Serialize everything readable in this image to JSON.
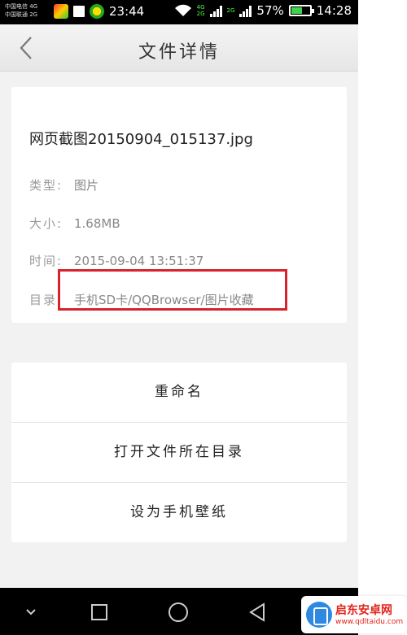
{
  "status_bar": {
    "carrier_line1": "中国电信 4G",
    "carrier_line2": "中国联通 2G",
    "left_time": "23:44",
    "net_tag_top": "4G",
    "net_tag_bottom": "2G",
    "net_tag_right": "2G",
    "battery_text": "57%",
    "battery_level": 0.57,
    "clock": "14:28"
  },
  "title_bar": {
    "title": "文件详情",
    "back_icon": "chevron-left-icon"
  },
  "file_info": {
    "file_name": "网页截图20150904_015137.jpg",
    "type_label": "类型:",
    "type_value": "图片",
    "size_label": "大小:",
    "size_value": "1.68MB",
    "time_label": "时间:",
    "time_value": "2015-09-04 13:51:37",
    "dir_label": "目录:",
    "dir_value": "手机SD卡/QQBrowser/图片收藏"
  },
  "actions": {
    "rename": "重命名",
    "open_dir": "打开文件所在目录",
    "set_wallpaper": "设为手机壁纸"
  },
  "nav_bar": {
    "icons": [
      "chevron-down-icon",
      "square-icon",
      "circle-icon",
      "triangle-back-icon"
    ]
  },
  "watermark": {
    "title": "启东安卓网",
    "url": "www.qdltaidu.com"
  },
  "colors": {
    "highlight": "#d9232b",
    "background": "#f2f2f2",
    "battery_fill": "#3fd44a"
  }
}
